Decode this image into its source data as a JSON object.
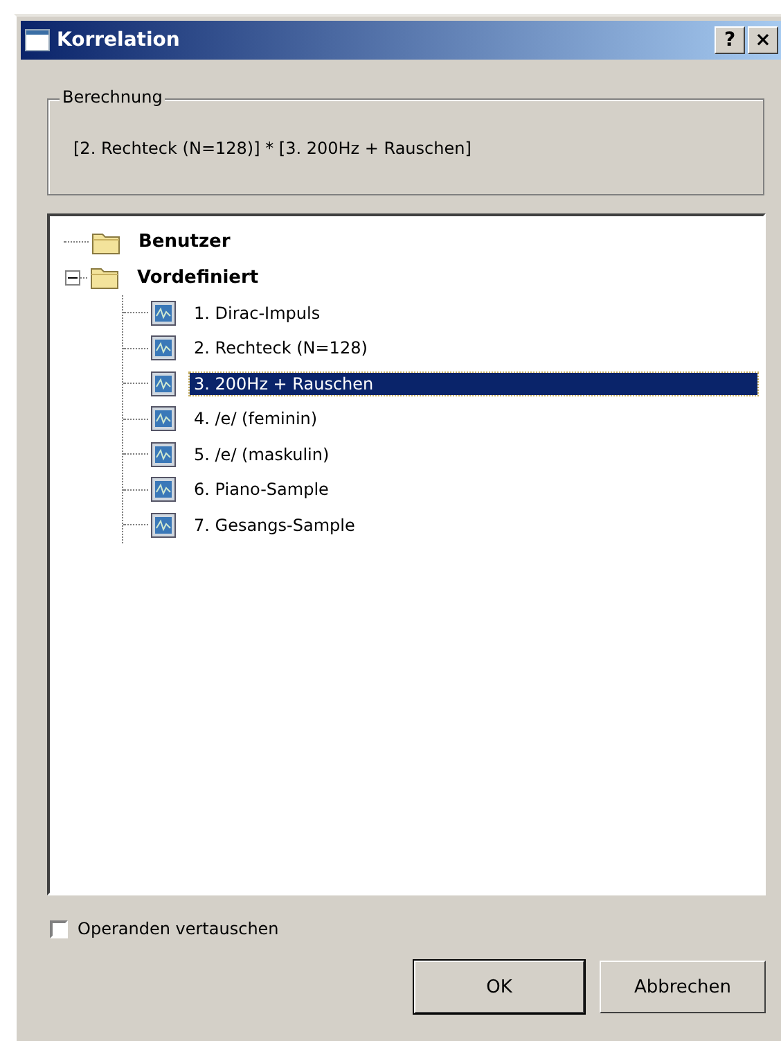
{
  "window": {
    "title": "Korrelation",
    "title_buttons": [
      "?",
      "×"
    ]
  },
  "calculation": {
    "label": "Berechnung",
    "formula": "[2. Rechteck (N=128)] * [3. 200Hz + Rauschen]"
  },
  "tree": [
    {
      "label": "Benutzer",
      "kind": "folder",
      "selected": false
    },
    {
      "label": "Vordefiniert",
      "kind": "folder",
      "selected": false,
      "expanded": true,
      "children": [
        {
          "label": "1. Dirac-Impuls",
          "kind": "signal",
          "selected": false
        },
        {
          "label": "2. Rechteck (N=128)",
          "kind": "signal",
          "selected": false
        },
        {
          "label": "3. 200Hz + Rauschen",
          "kind": "signal",
          "selected": true
        },
        {
          "label": "4. /e/ (feminin)",
          "kind": "signal",
          "selected": false
        },
        {
          "label": "5. /e/ (maskulin)",
          "kind": "signal",
          "selected": false
        },
        {
          "label": "6. Piano-Sample",
          "kind": "signal",
          "selected": false
        },
        {
          "label": "7. Gesangs-Sample",
          "kind": "signal",
          "selected": false
        }
      ]
    }
  ],
  "swap_operands": {
    "label": "Operanden vertauschen",
    "checked": false
  },
  "buttons": [
    "OK",
    "Abbrechen"
  ]
}
